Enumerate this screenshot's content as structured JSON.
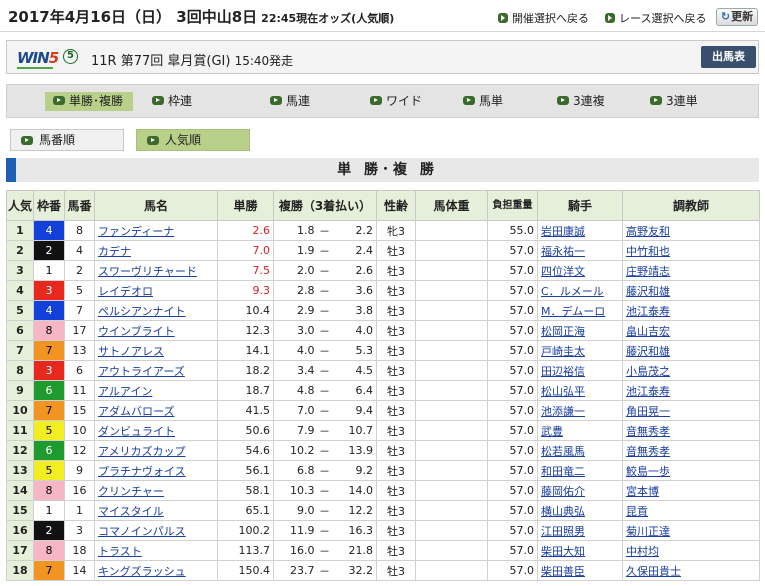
{
  "header": {
    "title": "2017年4月16日（日） 3回中山8日",
    "odds_time": "22:45現在オッズ(人気順)",
    "link_venue": "開催選択へ戻る",
    "link_race": "レース選択へ戻る",
    "refresh": "更新"
  },
  "race": {
    "logo_a": "WIN",
    "logo_b": "5",
    "circled": "5",
    "info": "11R 第77回 皐月賞(GI)",
    "start": "15:40発走",
    "shutsuba": "出馬表"
  },
  "tabs": [
    "単勝･複勝",
    "枠連",
    "馬連",
    "ワイド",
    "馬単",
    "3連複",
    "3連単"
  ],
  "sort": {
    "by_number": "馬番順",
    "by_popularity": "人気順"
  },
  "section_title": "単 勝･複 勝",
  "columns": {
    "pop": "人気",
    "waku": "枠番",
    "uma": "馬番",
    "name": "馬名",
    "win": "単勝",
    "place": "複勝（3着払い）",
    "sexage": "性齢",
    "weight": "馬体重",
    "burden": "負担重量",
    "jockey": "騎手",
    "trainer": "調教師"
  },
  "colors": {
    "frame_1": "#ffffff",
    "frame_2": "#111111",
    "frame_3": "#e8281c",
    "frame_4": "#1240d8",
    "frame_5": "#f3ee22",
    "frame_6": "#1f9a2e",
    "frame_7": "#f29422",
    "frame_8": "#f6b6c6",
    "header_bg": "#e6efd9",
    "active_tab": "#b8d08a",
    "section_accent": "#1e5fb5",
    "odds_red": "#d42020"
  },
  "rows": [
    {
      "pop": "1",
      "waku": "4",
      "uma": "8",
      "name": "ファンディーナ",
      "win": "2.6",
      "pl": "1.8",
      "dash": "－",
      "ph": "2.2",
      "sexage": "牝3",
      "weight": "",
      "burden": "55.0",
      "jockey": "岩田康誠",
      "trainer": "高野友和"
    },
    {
      "pop": "2",
      "waku": "2",
      "uma": "4",
      "name": "カデナ",
      "win": "7.0",
      "pl": "1.9",
      "dash": "－",
      "ph": "2.4",
      "sexage": "牡3",
      "weight": "",
      "burden": "57.0",
      "jockey": "福永祐一",
      "trainer": "中竹和也"
    },
    {
      "pop": "3",
      "waku": "1",
      "uma": "2",
      "name": "スワーヴリチャード",
      "win": "7.5",
      "pl": "2.0",
      "dash": "－",
      "ph": "2.6",
      "sexage": "牡3",
      "weight": "",
      "burden": "57.0",
      "jockey": "四位洋文",
      "trainer": "庄野靖志"
    },
    {
      "pop": "4",
      "waku": "3",
      "uma": "5",
      "name": "レイデオロ",
      "win": "9.3",
      "pl": "2.8",
      "dash": "－",
      "ph": "3.6",
      "sexage": "牡3",
      "weight": "",
      "burden": "57.0",
      "jockey": "C．ルメール",
      "trainer": "藤沢和雄"
    },
    {
      "pop": "5",
      "waku": "4",
      "uma": "7",
      "name": "ペルシアンナイト",
      "win": "10.4",
      "pl": "2.9",
      "dash": "－",
      "ph": "3.8",
      "sexage": "牡3",
      "weight": "",
      "burden": "57.0",
      "jockey": "M．デムーロ",
      "trainer": "池江泰寿"
    },
    {
      "pop": "6",
      "waku": "8",
      "uma": "17",
      "name": "ウインブライト",
      "win": "12.3",
      "pl": "3.0",
      "dash": "－",
      "ph": "4.0",
      "sexage": "牡3",
      "weight": "",
      "burden": "57.0",
      "jockey": "松岡正海",
      "trainer": "畠山吉宏"
    },
    {
      "pop": "7",
      "waku": "7",
      "uma": "13",
      "name": "サトノアレス",
      "win": "14.1",
      "pl": "4.0",
      "dash": "－",
      "ph": "5.3",
      "sexage": "牡3",
      "weight": "",
      "burden": "57.0",
      "jockey": "戸崎圭太",
      "trainer": "藤沢和雄"
    },
    {
      "pop": "8",
      "waku": "3",
      "uma": "6",
      "name": "アウトライアーズ",
      "win": "18.2",
      "pl": "3.4",
      "dash": "－",
      "ph": "4.5",
      "sexage": "牡3",
      "weight": "",
      "burden": "57.0",
      "jockey": "田辺裕信",
      "trainer": "小島茂之"
    },
    {
      "pop": "9",
      "waku": "6",
      "uma": "11",
      "name": "アルアイン",
      "win": "18.7",
      "pl": "4.8",
      "dash": "－",
      "ph": "6.4",
      "sexage": "牡3",
      "weight": "",
      "burden": "57.0",
      "jockey": "松山弘平",
      "trainer": "池江泰寿"
    },
    {
      "pop": "10",
      "waku": "7",
      "uma": "15",
      "name": "アダムバローズ",
      "win": "41.5",
      "pl": "7.0",
      "dash": "－",
      "ph": "9.4",
      "sexage": "牡3",
      "weight": "",
      "burden": "57.0",
      "jockey": "池添謙一",
      "trainer": "角田晃一"
    },
    {
      "pop": "11",
      "waku": "5",
      "uma": "10",
      "name": "ダンビュライト",
      "win": "50.6",
      "pl": "7.9",
      "dash": "－",
      "ph": "10.7",
      "sexage": "牡3",
      "weight": "",
      "burden": "57.0",
      "jockey": "武豊",
      "trainer": "音無秀孝"
    },
    {
      "pop": "12",
      "waku": "6",
      "uma": "12",
      "name": "アメリカズカップ",
      "win": "54.6",
      "pl": "10.2",
      "dash": "－",
      "ph": "13.9",
      "sexage": "牡3",
      "weight": "",
      "burden": "57.0",
      "jockey": "松若風馬",
      "trainer": "音無秀孝"
    },
    {
      "pop": "13",
      "waku": "5",
      "uma": "9",
      "name": "プラチナヴォイス",
      "win": "56.1",
      "pl": "6.8",
      "dash": "－",
      "ph": "9.2",
      "sexage": "牡3",
      "weight": "",
      "burden": "57.0",
      "jockey": "和田竜二",
      "trainer": "鮫島一歩"
    },
    {
      "pop": "14",
      "waku": "8",
      "uma": "16",
      "name": "クリンチャー",
      "win": "58.1",
      "pl": "10.3",
      "dash": "－",
      "ph": "14.0",
      "sexage": "牡3",
      "weight": "",
      "burden": "57.0",
      "jockey": "藤岡佑介",
      "trainer": "宮本博"
    },
    {
      "pop": "15",
      "waku": "1",
      "uma": "1",
      "name": "マイスタイル",
      "win": "65.1",
      "pl": "9.0",
      "dash": "－",
      "ph": "12.2",
      "sexage": "牡3",
      "weight": "",
      "burden": "57.0",
      "jockey": "横山典弘",
      "trainer": "昆貢"
    },
    {
      "pop": "16",
      "waku": "2",
      "uma": "3",
      "name": "コマノインパルス",
      "win": "100.2",
      "pl": "11.9",
      "dash": "－",
      "ph": "16.3",
      "sexage": "牡3",
      "weight": "",
      "burden": "57.0",
      "jockey": "江田照男",
      "trainer": "菊川正達"
    },
    {
      "pop": "17",
      "waku": "8",
      "uma": "18",
      "name": "トラスト",
      "win": "113.7",
      "pl": "16.0",
      "dash": "－",
      "ph": "21.8",
      "sexage": "牡3",
      "weight": "",
      "burden": "57.0",
      "jockey": "柴田大知",
      "trainer": "中村均"
    },
    {
      "pop": "18",
      "waku": "7",
      "uma": "14",
      "name": "キングズラッシュ",
      "win": "150.4",
      "pl": "23.7",
      "dash": "－",
      "ph": "32.2",
      "sexage": "牡3",
      "weight": "",
      "burden": "57.0",
      "jockey": "柴田善臣",
      "trainer": "久保田貴士"
    }
  ]
}
